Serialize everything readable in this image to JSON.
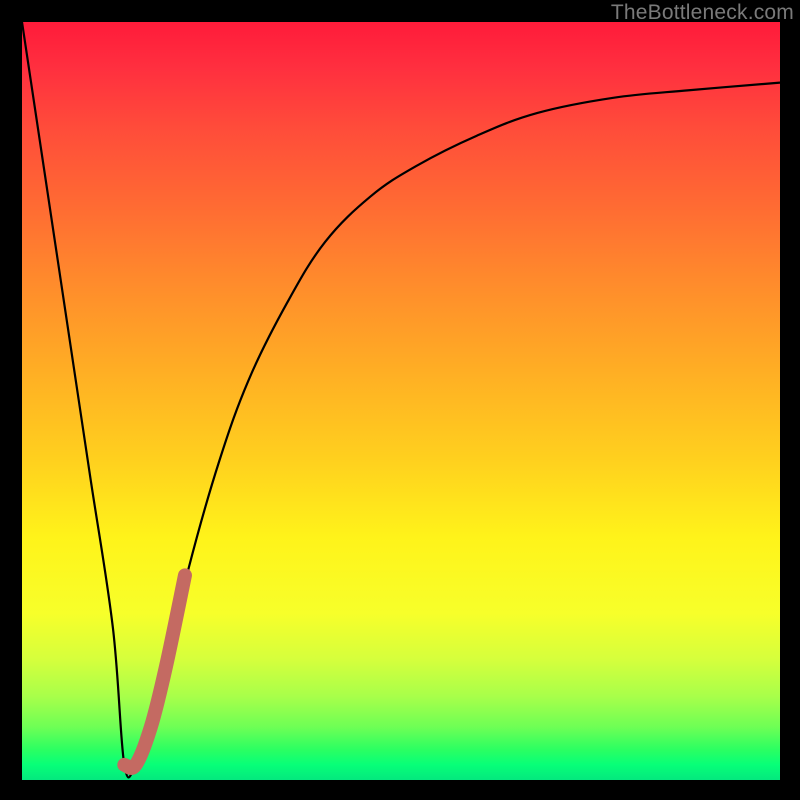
{
  "watermark": "TheBottleneck.com",
  "colors": {
    "curve": "#000000",
    "overlay": "#c46a62",
    "gradient_top": "#ff1b3a",
    "gradient_bottom": "#04e87e"
  },
  "chart_data": {
    "type": "line",
    "title": "",
    "xlabel": "",
    "ylabel": "",
    "xlim": [
      0,
      1
    ],
    "ylim": [
      0,
      1
    ],
    "series": [
      {
        "name": "bottleneck-curve",
        "x": [
          0.0,
          0.03,
          0.06,
          0.09,
          0.12,
          0.135,
          0.15,
          0.17,
          0.19,
          0.22,
          0.26,
          0.3,
          0.35,
          0.4,
          0.46,
          0.52,
          0.6,
          0.68,
          0.78,
          0.88,
          1.0
        ],
        "y": [
          1.0,
          0.8,
          0.6,
          0.4,
          0.2,
          0.02,
          0.02,
          0.07,
          0.15,
          0.28,
          0.42,
          0.53,
          0.63,
          0.71,
          0.77,
          0.81,
          0.85,
          0.88,
          0.9,
          0.91,
          0.92
        ]
      },
      {
        "name": "highlight-segment",
        "x": [
          0.135,
          0.15,
          0.17,
          0.19,
          0.215
        ],
        "y": [
          0.02,
          0.02,
          0.07,
          0.15,
          0.27
        ]
      }
    ]
  }
}
